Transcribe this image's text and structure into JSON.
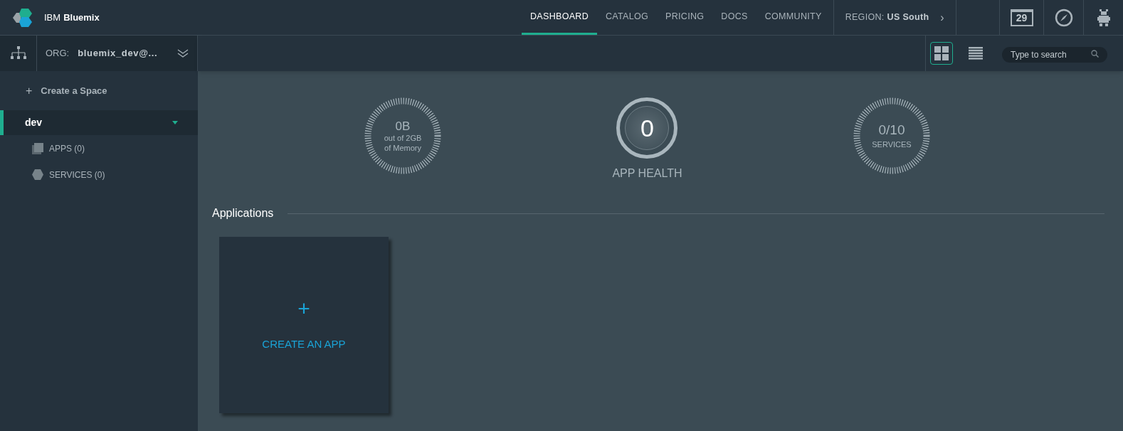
{
  "brand": {
    "prefix": "IBM",
    "name": "Bluemix"
  },
  "nav": [
    {
      "label": "DASHBOARD",
      "selected": true
    },
    {
      "label": "CATALOG",
      "selected": false
    },
    {
      "label": "PRICING",
      "selected": false
    },
    {
      "label": "DOCS",
      "selected": false
    },
    {
      "label": "COMMUNITY",
      "selected": false
    }
  ],
  "region": {
    "label": "REGION:",
    "value": "US South",
    "arrow": "›"
  },
  "calendar_day": "29",
  "org": {
    "label": "ORG:",
    "value": "bluemix_dev@..."
  },
  "views": [
    {
      "kind": "grid",
      "selected": true
    },
    {
      "kind": "list",
      "selected": false
    }
  ],
  "search": {
    "placeholder": "Type to search"
  },
  "sidebar": {
    "create": {
      "icon": "+",
      "label": "Create a Space"
    },
    "spaces": [
      {
        "name": "dev",
        "selected": true,
        "expanded": true,
        "children": [
          {
            "kind": "apps",
            "label": "APPS (0)"
          },
          {
            "kind": "services",
            "label": "SERVICES (0)"
          }
        ]
      }
    ]
  },
  "gauges": {
    "memory": {
      "value": "0B",
      "lines": [
        "out of 2GB",
        "of Memory"
      ]
    },
    "health": {
      "value": "0",
      "label": "APP HEALTH"
    },
    "services": {
      "value": "0/10",
      "label": "SERVICES"
    }
  },
  "applications": {
    "title": "Applications",
    "create": {
      "icon": "+",
      "label": "CREATE AN APP"
    }
  }
}
